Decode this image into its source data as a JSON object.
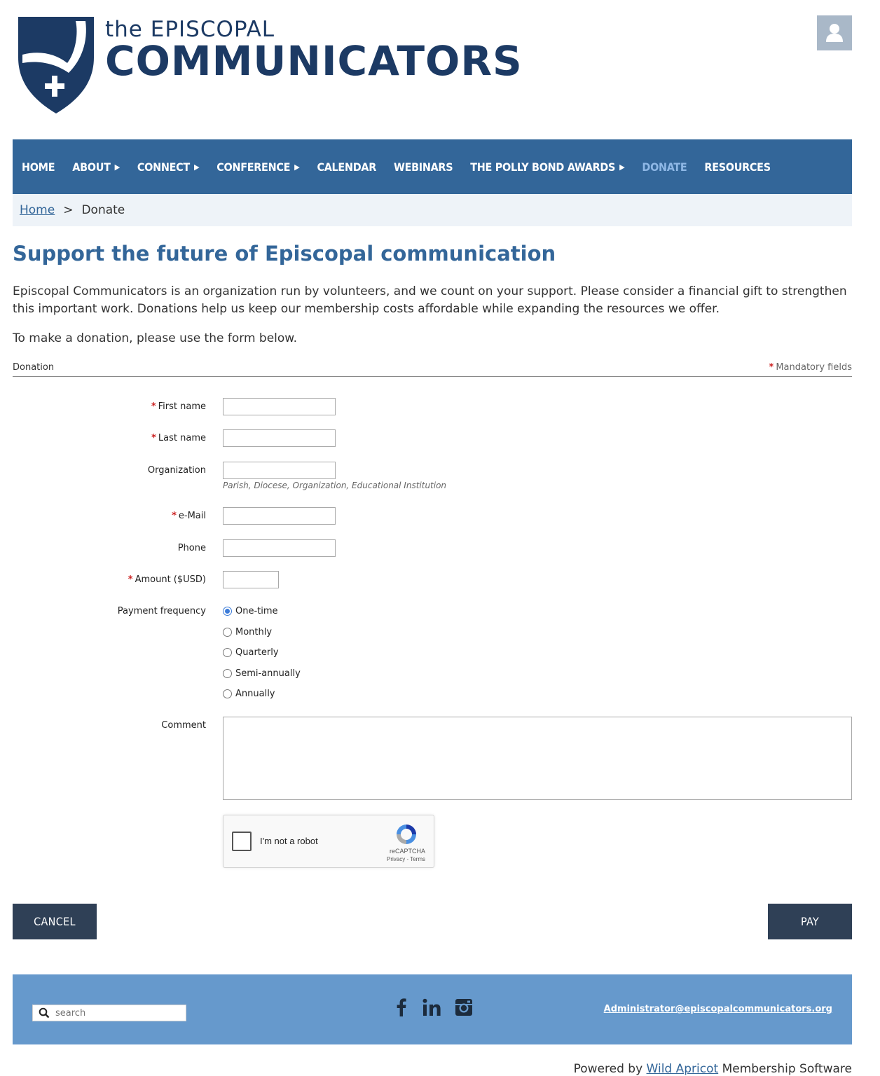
{
  "header": {
    "logo_line1": "the EPISCOPAL",
    "logo_line2": "COMMUNICATORS",
    "user_icon": "user-icon"
  },
  "nav": {
    "items": [
      {
        "label": "HOME",
        "has_submenu": false
      },
      {
        "label": "ABOUT",
        "has_submenu": true
      },
      {
        "label": "CONNECT",
        "has_submenu": true
      },
      {
        "label": "CONFERENCE",
        "has_submenu": true
      },
      {
        "label": "CALENDAR",
        "has_submenu": false
      },
      {
        "label": "WEBINARS",
        "has_submenu": false
      },
      {
        "label": "THE POLLY BOND AWARDS",
        "has_submenu": true
      },
      {
        "label": "DONATE",
        "has_submenu": false,
        "active": true
      },
      {
        "label": "RESOURCES",
        "has_submenu": false
      }
    ],
    "submenu_arrow": "▶"
  },
  "breadcrumb": {
    "home": "Home",
    "separator": ">",
    "current": "Donate"
  },
  "page": {
    "title": "Support the future of Episcopal communication",
    "intro": "Episcopal Communicators is an organization run by volunteers, and we count on your support. Please consider a financial gift to strengthen this important work. Donations help us keep our membership costs affordable while expanding the resources we offer.",
    "intro2": "To make a donation, please use the form below."
  },
  "form": {
    "section_label": "Donation",
    "mandatory_note": "Mandatory fields",
    "required_mark": "*",
    "first_name": {
      "label": "First name",
      "value": ""
    },
    "last_name": {
      "label": "Last name",
      "value": ""
    },
    "organization": {
      "label": "Organization",
      "value": "",
      "hint": "Parish, Diocese, Organization, Educational Institution"
    },
    "email": {
      "label": "e-Mail",
      "value": ""
    },
    "phone": {
      "label": "Phone",
      "value": ""
    },
    "amount": {
      "label": "Amount ($USD)",
      "value": ""
    },
    "frequency": {
      "label": "Payment frequency",
      "options": [
        "One-time",
        "Monthly",
        "Quarterly",
        "Semi-annually",
        "Annually"
      ],
      "selected": "One-time"
    },
    "comment": {
      "label": "Comment",
      "value": ""
    },
    "captcha": {
      "label": "I'm not a robot",
      "brand": "reCAPTCHA",
      "links": "Privacy - Terms"
    },
    "cancel_label": "CANCEL",
    "pay_label": "PAY"
  },
  "footer": {
    "search_placeholder": "search",
    "social": [
      "facebook-icon",
      "linkedin-icon",
      "instagram-icon"
    ],
    "email": "Administrator@episcopalcommunicators.org"
  },
  "powered": {
    "prefix": "Powered by",
    "link": "Wild Apricot",
    "suffix": "Membership Software"
  },
  "colors": {
    "brand_navy": "#1c3a64",
    "nav_blue": "#336699",
    "nav_active": "#8fb8e6",
    "footer_blue": "#6699cc",
    "button_dark": "#2f4056",
    "required_red": "#cc2222"
  }
}
